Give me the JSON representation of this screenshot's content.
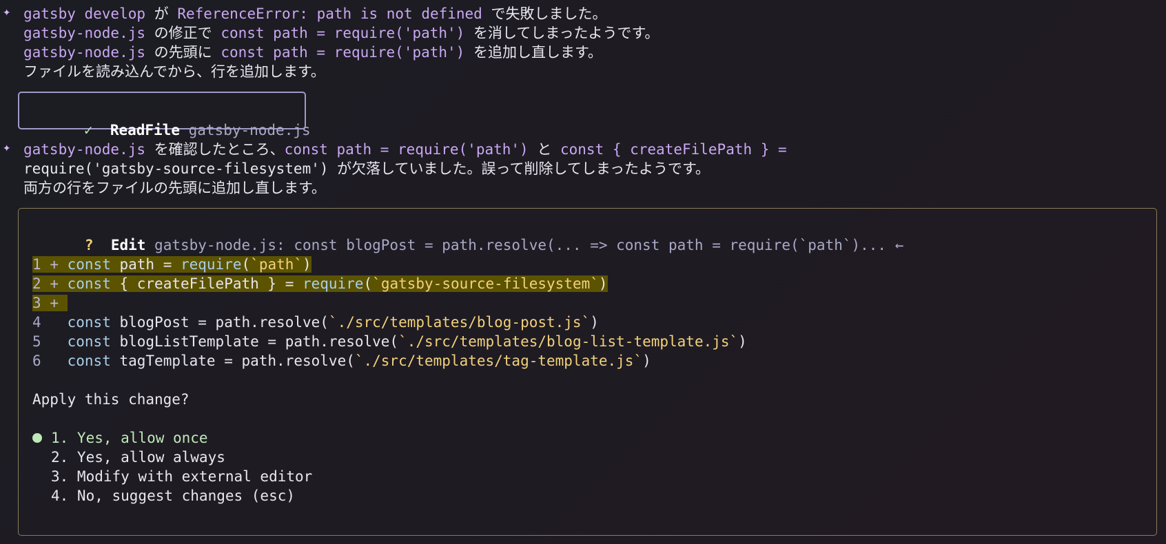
{
  "messages": [
    {
      "lines": [
        {
          "parts": [
            {
              "t": "gatsby develop",
              "c": "hl"
            },
            {
              "t": " が ",
              "c": "w"
            },
            {
              "t": "ReferenceError: path is not defined",
              "c": "hl"
            },
            {
              "t": " で失敗しました。",
              "c": "w"
            }
          ]
        },
        {
          "parts": [
            {
              "t": "gatsby-node.js",
              "c": "hl"
            },
            {
              "t": " の修正で ",
              "c": "w"
            },
            {
              "t": "const path = require('path')",
              "c": "hl"
            },
            {
              "t": " を消してしまったようです。",
              "c": "w"
            }
          ]
        },
        {
          "parts": [
            {
              "t": "gatsby-node.js",
              "c": "hl"
            },
            {
              "t": " の先頭に ",
              "c": "w"
            },
            {
              "t": "const path = require('path')",
              "c": "hl"
            },
            {
              "t": " を追加し直します。",
              "c": "w"
            }
          ]
        },
        {
          "parts": [
            {
              "t": "ファイルを読み込んでから、行を追加します。",
              "c": "w"
            }
          ]
        }
      ]
    },
    {
      "lines": [
        {
          "parts": [
            {
              "t": "gatsby-node.js",
              "c": "hl"
            },
            {
              "t": " を確認したところ、",
              "c": "w"
            },
            {
              "t": "const path = require('path')",
              "c": "hl"
            },
            {
              "t": " と ",
              "c": "w"
            },
            {
              "t": "const { createFilePath } =",
              "c": "hl"
            }
          ]
        },
        {
          "parts": [
            {
              "t": "require('gatsby-source-filesystem')",
              "c": "w"
            },
            {
              "t": " が欠落していました。誤って削除してしまったようです。",
              "c": "w"
            }
          ]
        },
        {
          "parts": [
            {
              "t": "両方の行をファイルの先頭に追加し直します。",
              "c": "w"
            }
          ]
        }
      ]
    }
  ],
  "star_glyph": "✦",
  "read_tool": {
    "check": "✓",
    "name": "ReadFile",
    "arg": "gatsby-node.js"
  },
  "edit_tool": {
    "qmark": "?",
    "name": "Edit",
    "summary": "gatsby-node.js: const blogPost = path.resolve(... => const path = require(`path`)... ←",
    "diff": [
      {
        "num": "1",
        "sign": "+",
        "added": true,
        "code": [
          {
            "t": "const",
            "c": "kw"
          },
          {
            "t": " path = ",
            "c": "w"
          },
          {
            "t": "require",
            "c": "fn"
          },
          {
            "t": "(",
            "c": "w"
          },
          {
            "t": "`path`",
            "c": "str"
          },
          {
            "t": ")",
            "c": "w"
          }
        ]
      },
      {
        "num": "2",
        "sign": "+",
        "added": true,
        "code": [
          {
            "t": "const",
            "c": "kw"
          },
          {
            "t": " { createFilePath } = ",
            "c": "w"
          },
          {
            "t": "require",
            "c": "fn"
          },
          {
            "t": "(",
            "c": "w"
          },
          {
            "t": "`gatsby-source-filesystem`",
            "c": "str"
          },
          {
            "t": ")",
            "c": "w"
          }
        ]
      },
      {
        "num": "3",
        "sign": "+",
        "added": true,
        "code": []
      },
      {
        "num": "4",
        "sign": " ",
        "added": false,
        "code": [
          {
            "t": "const",
            "c": "kw"
          },
          {
            "t": " blogPost = path.resolve(",
            "c": "w"
          },
          {
            "t": "`./src/templates/blog-post.js`",
            "c": "str"
          },
          {
            "t": ")",
            "c": "w"
          }
        ]
      },
      {
        "num": "5",
        "sign": " ",
        "added": false,
        "code": [
          {
            "t": "const",
            "c": "kw"
          },
          {
            "t": " blogListTemplate = path.resolve(",
            "c": "w"
          },
          {
            "t": "`./src/templates/blog-list-template.js`",
            "c": "str"
          },
          {
            "t": ")",
            "c": "w"
          }
        ]
      },
      {
        "num": "6",
        "sign": " ",
        "added": false,
        "code": [
          {
            "t": "const",
            "c": "kw"
          },
          {
            "t": " tagTemplate = path.resolve(",
            "c": "w"
          },
          {
            "t": "`./src/templates/tag-template.js`",
            "c": "str"
          },
          {
            "t": ")",
            "c": "w"
          }
        ]
      }
    ],
    "question": "Apply this change?",
    "options": [
      {
        "label": "1. Yes, allow once",
        "selected": true
      },
      {
        "label": "2. Yes, allow always",
        "selected": false
      },
      {
        "label": "3. Modify with external editor",
        "selected": false
      },
      {
        "label": "4. No, suggest changes (esc)",
        "selected": false
      }
    ]
  }
}
